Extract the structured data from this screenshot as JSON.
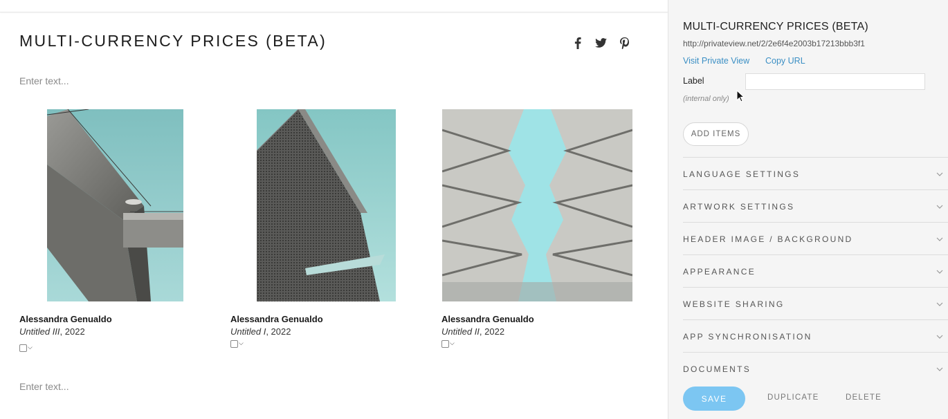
{
  "main": {
    "title": "MULTI-CURRENCY PRICES (BETA)",
    "text_placeholder_top": "Enter text...",
    "text_placeholder_bottom": "Enter text...",
    "social": [
      "facebook-icon",
      "twitter-icon",
      "pinterest-icon"
    ],
    "artworks": [
      {
        "artist": "Alessandra Genualdo",
        "title": "Untitled III",
        "year": ", 2022"
      },
      {
        "artist": "Alessandra Genualdo",
        "title": "Untitled I",
        "year": ", 2022"
      },
      {
        "artist": "Alessandra Genualdo",
        "title": "Untitled II",
        "year": ", 2022"
      }
    ]
  },
  "panel": {
    "title": "MULTI-CURRENCY PRICES (BETA)",
    "url": "http://privateview.net/2/2e6f4e2003b17213bbb3f1",
    "visit_link": "Visit Private View",
    "copy_link": "Copy URL",
    "label": "Label",
    "label_value": "",
    "internal_note": "(internal only)",
    "add_items": "ADD ITEMS",
    "sections": [
      "LANGUAGE SETTINGS",
      "ARTWORK SETTINGS",
      "HEADER IMAGE / BACKGROUND",
      "APPEARANCE",
      "WEBSITE SHARING",
      "APP SYNCHRONISATION",
      "DOCUMENTS"
    ],
    "save": "SAVE",
    "duplicate": "DUPLICATE",
    "delete": "DELETE"
  },
  "colors": {
    "accent": "#7cc6f2",
    "link": "#3b8fc4",
    "sky": "#8fc9c9"
  }
}
